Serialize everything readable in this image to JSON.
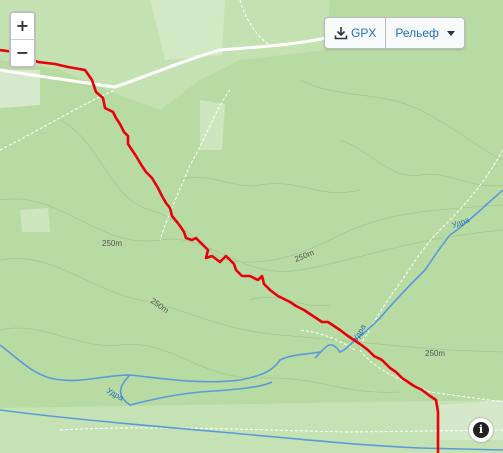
{
  "controls": {
    "zoom_in": "+",
    "zoom_out": "−",
    "gpx_label": "GPX",
    "layer_label": "Рельеф",
    "info_label": "i"
  },
  "map": {
    "contour_labels": [
      "250m",
      "250m",
      "250m",
      "250m"
    ],
    "river_labels": [
      "Удра",
      "Удра",
      "Удра"
    ],
    "colors": {
      "forest": "#b9dca5",
      "clearing": "#d6e9c8",
      "track": "#e8000b",
      "river": "#5b9ad9",
      "road": "#ffffff"
    }
  }
}
